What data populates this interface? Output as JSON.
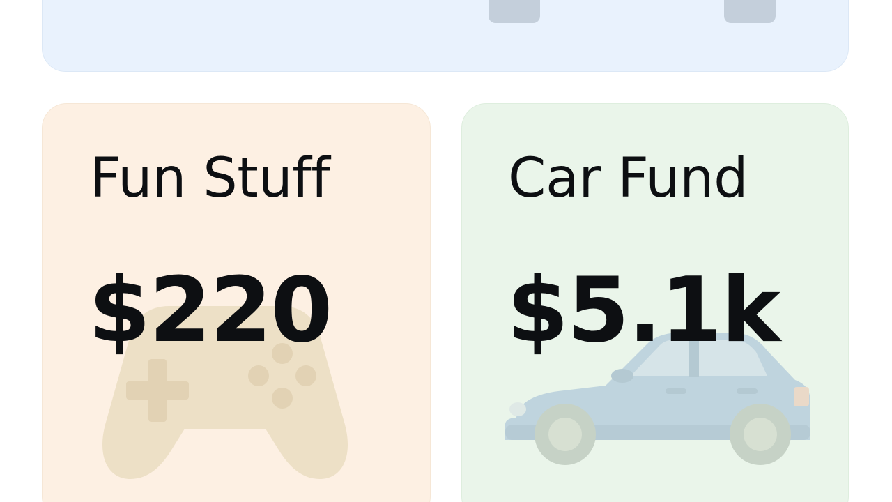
{
  "cards": [
    {
      "title": "Fun Stuff",
      "amount": "$220",
      "icon": "game-controller-icon",
      "background": "#fdf0e3"
    },
    {
      "title": "Car Fund",
      "amount": "$5.1k",
      "icon": "car-icon",
      "background": "#eaf5ea"
    }
  ],
  "top_card": {
    "background": "#e9f2fd"
  }
}
